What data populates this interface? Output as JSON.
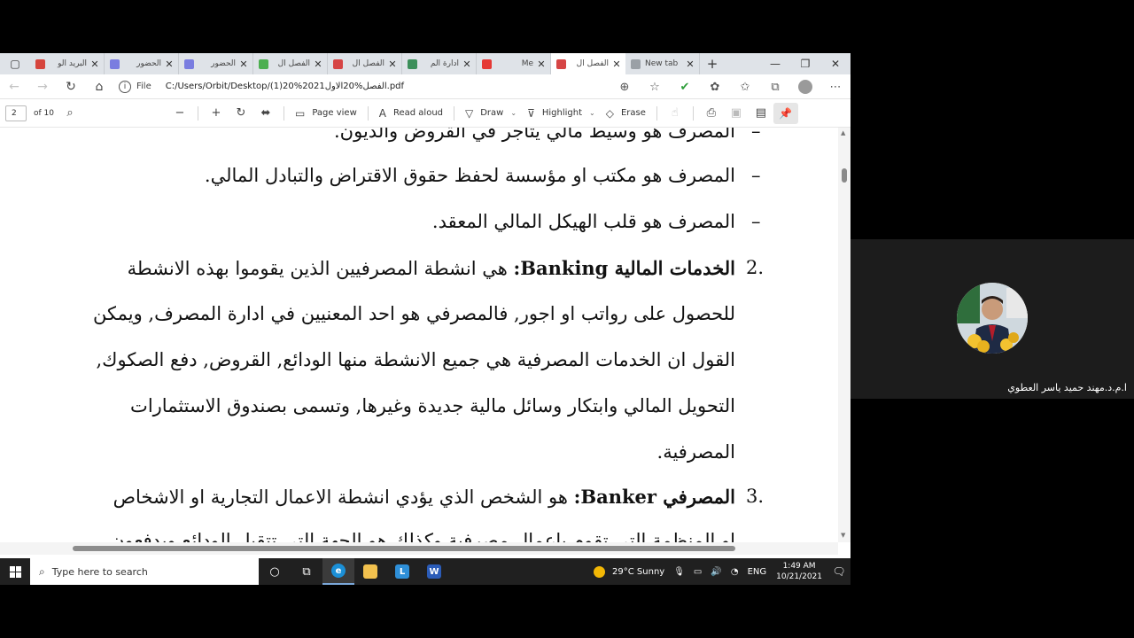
{
  "browser": {
    "tabs": [
      {
        "label": "البريد الو",
        "fav": "#d6453d",
        "active": false
      },
      {
        "label": "الحضور",
        "fav": "#7a7de0",
        "active": false
      },
      {
        "label": "الحضور",
        "fav": "#7a7de0",
        "active": false
      },
      {
        "label": "الفصل ال",
        "fav": "#4caf50",
        "active": false
      },
      {
        "label": "الفصل ال",
        "fav": "#d64545",
        "active": false
      },
      {
        "label": "ادارة الم",
        "fav": "#3c8f5a",
        "active": false
      },
      {
        "label": "Me",
        "fav": "#e53935",
        "active": false
      },
      {
        "label": "الفصل ال",
        "fav": "#d64545",
        "active": true
      },
      {
        "label": "New tab",
        "fav": "#9aa0a6",
        "active": false
      }
    ],
    "address": {
      "scheme": "File",
      "path": "C:/Users/Orbit/Desktop/(1)20%2021الفصل%20الاول.pdf"
    }
  },
  "pdf_toolbar": {
    "page_current": "2",
    "page_total": "of 10",
    "page_view": "Page view",
    "read_aloud": "Read aloud",
    "draw": "Draw",
    "highlight": "Highlight",
    "erase": "Erase"
  },
  "document": {
    "line0": "المصرف هو وسيط مالي يتاجر في القروض والديون.",
    "line1": "المصرف هو مكتب او مؤسسة لحفظ حقوق الاقتراض والتبادل المالي.",
    "line2": "المصرف هو قلب الهيكل المالي المعقد.",
    "item2_num": "2.",
    "item2_title": "الخدمات المالية Banking:",
    "item2_line1": "هي انشطة المصرفيين الذين يقوموا بهذه الانشطة",
    "item2_line2": "للحصول على رواتب او اجور, فالمصرفي هو احد المعنيين في ادارة المصرف, ويمكن",
    "item2_line3": "القول ان الخدمات المصرفية هي جميع الانشطة منها الودائع, القروض, دفع الصكوك,",
    "item2_line4": "التحويل المالي وابتكار وسائل مالية جديدة وغيرها, وتسمى بصندوق الاستثمارات",
    "item2_line5": "المصرفية.",
    "item3_num": "3.",
    "item3_title": "المصرفي Banker:",
    "item3_line1": "هو الشخص الذي يؤدي انشطة الاعمال التجارية او الاشخاص",
    "item3_line2": "او المنظمة التي تقوم باعمال مصرفية وكذلك هو الجهة التي تتقبل الودائع ويدفعون"
  },
  "taskbar": {
    "search_placeholder": "Type here to search",
    "weather": "29°C  Sunny",
    "lang": "ENG",
    "time": "1:49 AM",
    "date": "10/21/2021"
  },
  "participant": {
    "name": "ا.م.د.مهند حميد ياسر العطوي"
  }
}
